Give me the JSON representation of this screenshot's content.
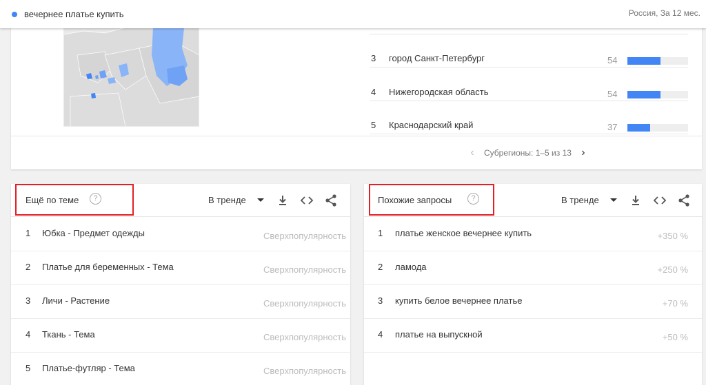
{
  "topbar": {
    "search_term": "вечернее платье купить",
    "meta": "Россия, За 12 мес.",
    "accent": "#4285f4"
  },
  "regions": {
    "rows": [
      {
        "rank": "3",
        "name": "город Санкт-Петербург",
        "value": "54",
        "fill": 0.54
      },
      {
        "rank": "4",
        "name": "Нижегородская область",
        "value": "54",
        "fill": 0.54
      },
      {
        "rank": "5",
        "name": "Краснодарский край",
        "value": "37",
        "fill": 0.37
      }
    ],
    "pager": "Субрегионы: 1–5 из 13"
  },
  "topics": {
    "title": "Ещё по теме",
    "filter": "В тренде",
    "items": [
      {
        "rank": "1",
        "name": "Юбка - Предмет одежды",
        "value": "Сверхпопулярность"
      },
      {
        "rank": "2",
        "name": "Платье для беременных - Тема",
        "value": "Сверхпопулярность"
      },
      {
        "rank": "3",
        "name": "Личи - Растение",
        "value": "Сверхпопулярность"
      },
      {
        "rank": "4",
        "name": "Ткань - Тема",
        "value": "Сверхпопулярность"
      },
      {
        "rank": "5",
        "name": "Платье-футляр - Тема",
        "value": "Сверхпопулярность"
      }
    ]
  },
  "queries": {
    "title": "Похожие запросы",
    "filter": "В тренде",
    "items": [
      {
        "rank": "1",
        "name": "платье женское вечернее купить",
        "value": "+350 %"
      },
      {
        "rank": "2",
        "name": "ламода",
        "value": "+250 %"
      },
      {
        "rank": "3",
        "name": "купить белое вечернее платье",
        "value": "+70 %"
      },
      {
        "rank": "4",
        "name": "платье на выпускной",
        "value": "+50 %"
      }
    ]
  },
  "icons": {
    "help": "help-circle-icon",
    "download": "download-icon",
    "embed": "embed-code-icon",
    "share": "share-icon"
  },
  "colors": {
    "highlight_box": "#e31e24",
    "bar": "#4285f4",
    "map_region": "#8ab4f8"
  }
}
